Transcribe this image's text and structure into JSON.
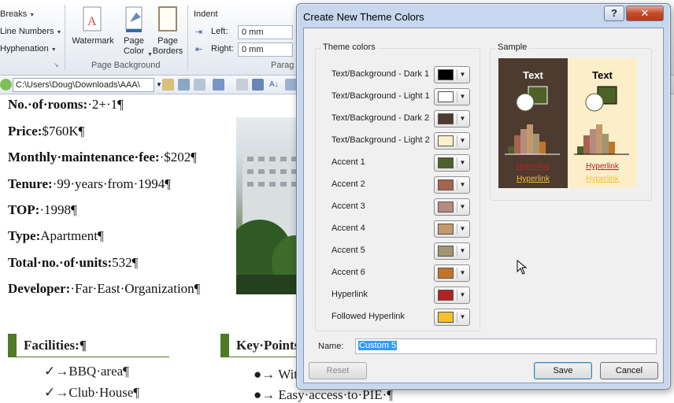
{
  "ribbon": {
    "breaks_label": "Breaks",
    "line_numbers_label": "Line Numbers",
    "hyphenation_label": "Hyphenation",
    "watermark_label": "Watermark",
    "page_color_label": "Page Color",
    "page_borders_label": "Page Borders",
    "page_background_group": "Page Background",
    "indent_label": "Indent",
    "left_label": "Left:",
    "left_value": "0 mm",
    "right_label": "Right:",
    "right_value": "0 mm",
    "paragraph_group_partial": "Parag"
  },
  "toolbar": {
    "path": "C:\\Users\\Doug\\Downloads\\AAA\\"
  },
  "document": {
    "lines": [
      {
        "label": "No.·of·rooms:",
        "value": "·2+·1¶"
      },
      {
        "label": "Price:",
        "value": "$760K¶"
      },
      {
        "label": "Monthly·maintenance·fee:",
        "value": "·$202¶"
      },
      {
        "label": "Tenure:",
        "value": "·99·years·from·1994¶"
      },
      {
        "label": "TOP:",
        "value": "·1998¶"
      },
      {
        "label": "Type:",
        "value": "Apartment¶"
      },
      {
        "label": "Total·no.·of·units:",
        "value": "532¶"
      },
      {
        "label": "Developer:",
        "value": "·Far·East·Organization¶"
      }
    ],
    "facilities_heading": "Facilities:¶",
    "facilities": [
      "✓→BBQ·area¶",
      "✓→Club·House¶"
    ],
    "keypoints_heading": "Key·Points",
    "keypoints": [
      "●→ Wit",
      "●→ Easy·access·to·PIE·¶"
    ]
  },
  "dialog": {
    "title": "Create New Theme Colors",
    "help_glyph": "?",
    "close_glyph": "✕",
    "theme_colors_label": "Theme colors",
    "sample_label": "Sample",
    "rows": [
      {
        "label": "Text/Background - Dark 1",
        "color": "#000000"
      },
      {
        "label": "Text/Background - Light 1",
        "color": "#ffffff"
      },
      {
        "label": "Text/Background - Dark 2",
        "color": "#4e3b30"
      },
      {
        "label": "Text/Background - Light 2",
        "color": "#fbeec9"
      },
      {
        "label": "Accent 1",
        "color": "#4e6128"
      },
      {
        "label": "Accent 2",
        "color": "#a5644e"
      },
      {
        "label": "Accent 3",
        "color": "#b58b80"
      },
      {
        "label": "Accent 4",
        "color": "#c3986d"
      },
      {
        "label": "Accent 5",
        "color": "#a19574"
      },
      {
        "label": "Accent 6",
        "color": "#c17529"
      },
      {
        "label": "Hyperlink",
        "color": "#b22222"
      },
      {
        "label": "Followed Hyperlink",
        "color": "#f5c02f"
      }
    ],
    "sample": {
      "text_label": "Text",
      "hyperlink_label": "Hyperlink",
      "followed_label": "Hyperlink",
      "dark_bg": "#4e3b30",
      "light_bg": "#fbeec9",
      "hyperlink_color": "#b22222",
      "followed_color": "#f5c02f"
    },
    "name_label": "Name:",
    "name_value": "Custom 5",
    "reset_label": "Reset",
    "save_label": "Save",
    "cancel_label": "Cancel"
  }
}
